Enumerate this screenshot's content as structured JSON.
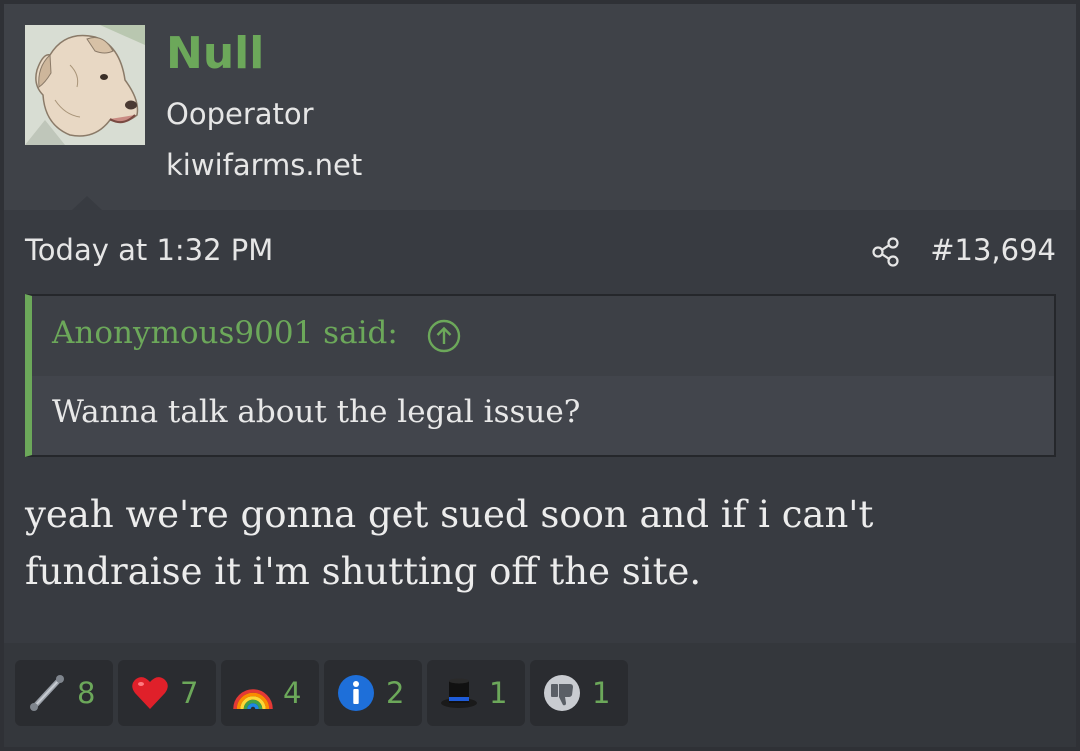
{
  "user": {
    "name": "Null",
    "title": "Ooperator",
    "banner": "kiwifarms.net"
  },
  "post": {
    "date": "Today at 1:32 PM",
    "number": "#13,694"
  },
  "quote": {
    "author_line": "Anonymous9001 said:",
    "body": "Wanna talk about the legal issue?"
  },
  "message": "yeah we're gonna get sued soon and if i can't fundraise it i'm shutting off the site.",
  "reactions": [
    {
      "icon": "pipe-icon",
      "count": "8"
    },
    {
      "icon": "heart-icon",
      "count": "7"
    },
    {
      "icon": "rainbow-icon",
      "count": "4"
    },
    {
      "icon": "info-icon",
      "count": "2"
    },
    {
      "icon": "top-hat-icon",
      "count": "1"
    },
    {
      "icon": "thumbs-down-icon",
      "count": "1"
    }
  ],
  "colors": {
    "accent": "#6ca85a",
    "background": "#383b41",
    "header": "#3f4248",
    "text": "#e6e6e6"
  }
}
